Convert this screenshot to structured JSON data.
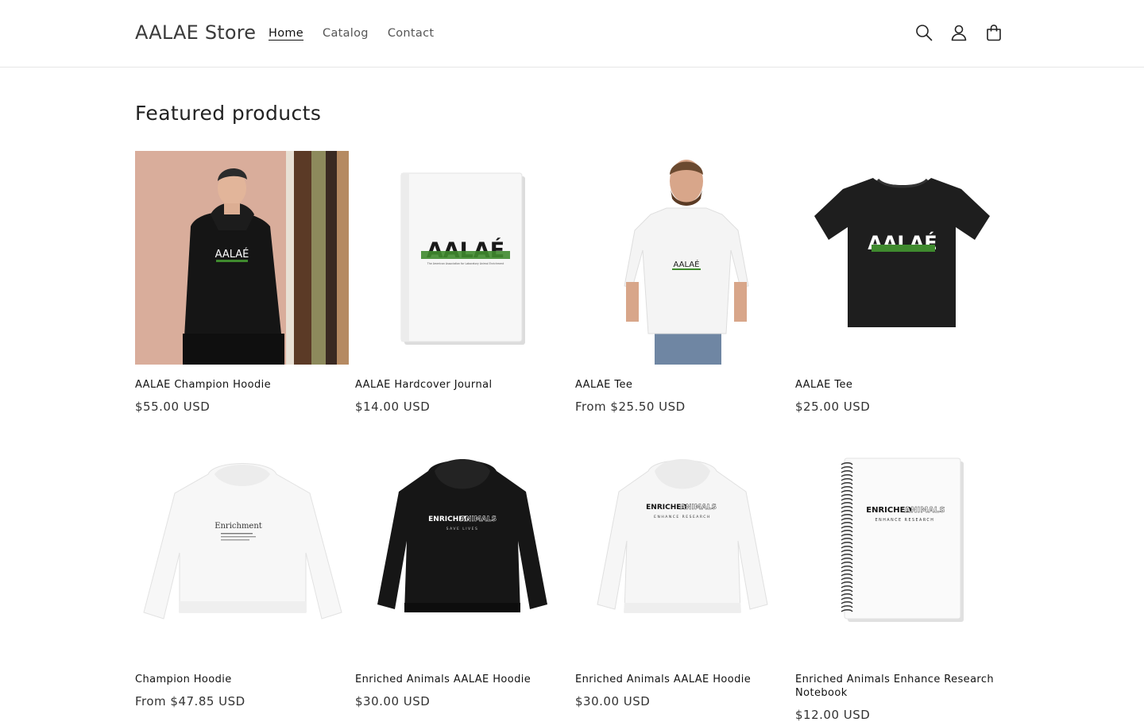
{
  "header": {
    "store_name": "AALAE Store",
    "nav": [
      {
        "label": "Home",
        "active": true
      },
      {
        "label": "Catalog",
        "active": false
      },
      {
        "label": "Contact",
        "active": false
      }
    ],
    "icons": [
      "search-icon",
      "account-icon",
      "cart-icon"
    ]
  },
  "featured": {
    "title": "Featured products",
    "products": [
      {
        "title": "AALAE Champion Hoodie",
        "price": "$55.00 USD",
        "image": "model-black-hoodie"
      },
      {
        "title": "AALAE Hardcover Journal",
        "price": "$14.00 USD",
        "image": "hardcover-journal"
      },
      {
        "title": "AALAE Tee",
        "price": "From $25.50 USD",
        "image": "model-white-tee"
      },
      {
        "title": "AALAE Tee",
        "price": "$25.00 USD",
        "image": "black-tee"
      },
      {
        "title": "Champion Hoodie",
        "price": "From $47.85 USD",
        "image": "white-hoodie-back"
      },
      {
        "title": "Enriched Animals AALAE Hoodie",
        "price": "$30.00 USD",
        "image": "black-hoodie"
      },
      {
        "title": "Enriched Animals AALAE Hoodie",
        "price": "$30.00 USD",
        "image": "white-hoodie"
      },
      {
        "title": "Enriched Animals Enhance Research Notebook",
        "price": "$12.00 USD",
        "image": "spiral-notebook"
      }
    ]
  },
  "graphics": {
    "aalae_logo": "AALAÉ",
    "journal_subtitle": "The American Association for Laboratory Animal Enrichment",
    "hoodie_front_word": "Enrichment",
    "enriched": "ENRICHED",
    "animals": "ANIMALS",
    "save_lives": "SAVE LIVES",
    "enhance_research": "ENHANCE RESEARCH"
  },
  "colors": {
    "text": "#121212",
    "muted": "#555555",
    "border": "#e6e6e6",
    "hoodie_black": "#161616",
    "logo_green": "#3f8a2e"
  }
}
